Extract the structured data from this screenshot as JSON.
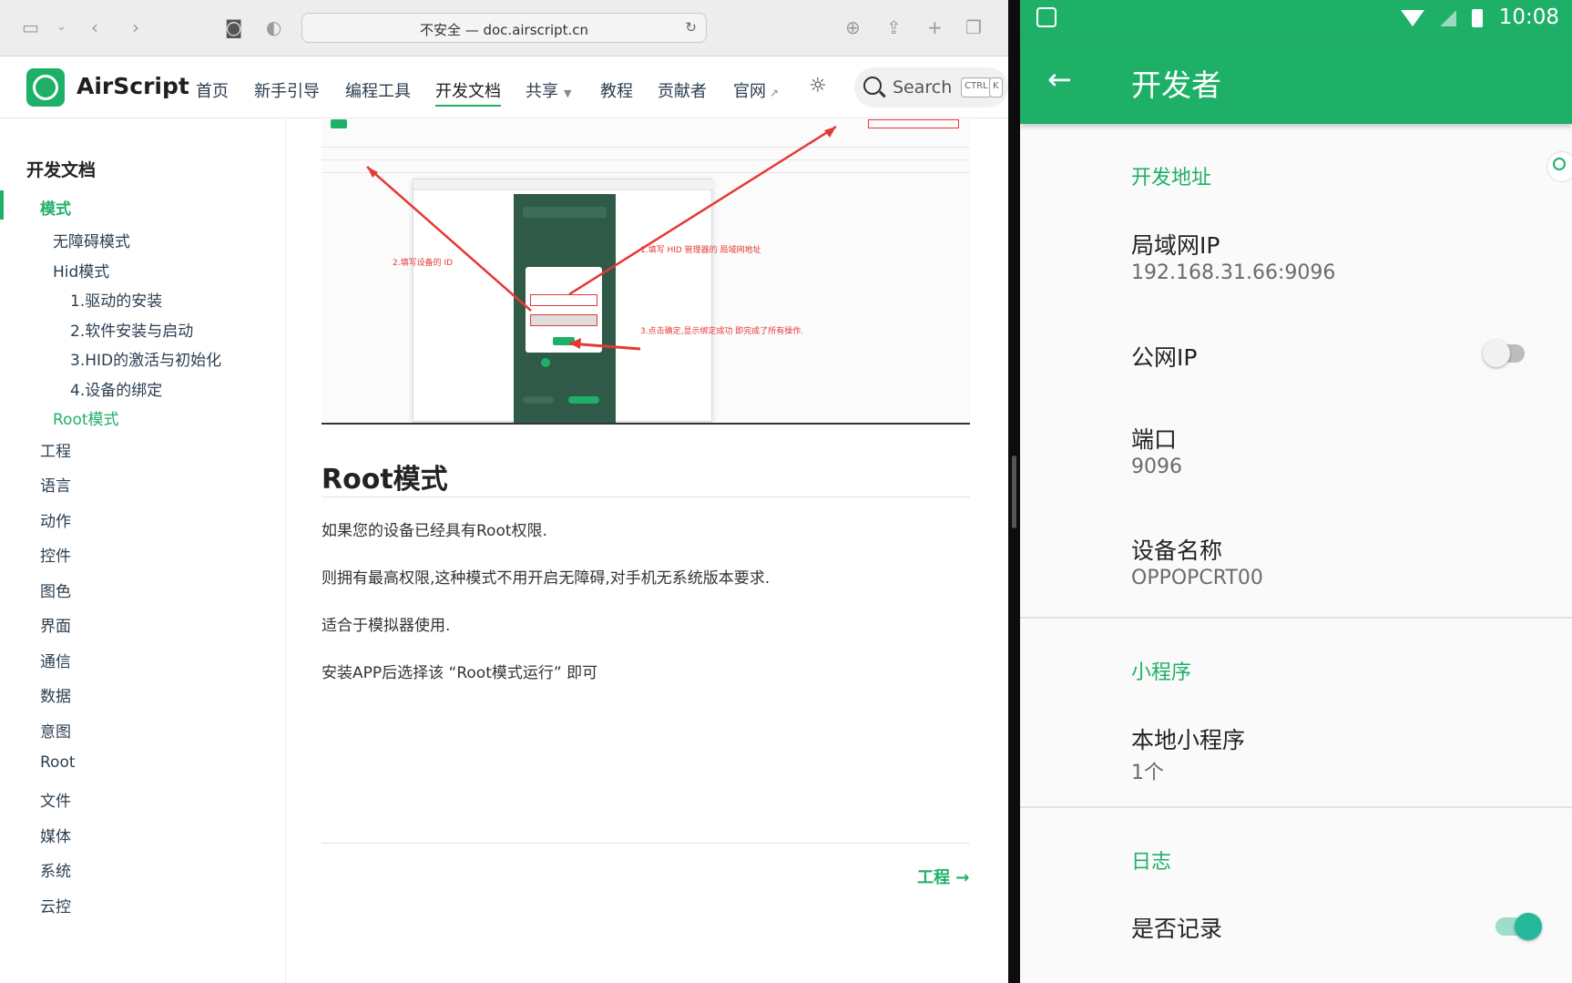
{
  "browser": {
    "address": "不安全 — doc.airscript.cn",
    "brand": "AirScript",
    "nav": [
      {
        "label": "首页"
      },
      {
        "label": "新手引导"
      },
      {
        "label": "编程工具"
      },
      {
        "label": "开发文档"
      },
      {
        "label": "共享"
      },
      {
        "label": "教程"
      },
      {
        "label": "贡献者"
      },
      {
        "label": "官网"
      }
    ],
    "search": {
      "placeholder": "Search",
      "key1": "CTRL",
      "key2": "K"
    },
    "sidebar": {
      "title": "开发文档",
      "items": [
        {
          "label": "模式"
        },
        {
          "label": "无障碍模式"
        },
        {
          "label": "Hid模式"
        },
        {
          "label": "1.驱动的安装"
        },
        {
          "label": "2.软件安装与启动"
        },
        {
          "label": "3.HID的激活与初始化"
        },
        {
          "label": "4.设备的绑定"
        },
        {
          "label": "Root模式"
        },
        {
          "label": "工程"
        },
        {
          "label": "语言"
        },
        {
          "label": "动作"
        },
        {
          "label": "控件"
        },
        {
          "label": "图色"
        },
        {
          "label": "界面"
        },
        {
          "label": "通信"
        },
        {
          "label": "数据"
        },
        {
          "label": "意图"
        },
        {
          "label": "Root"
        },
        {
          "label": "文件"
        },
        {
          "label": "媒体"
        },
        {
          "label": "系统"
        },
        {
          "label": "云控"
        }
      ]
    },
    "figure": {
      "annotations": [
        "1.填写 HID 管理器的 局域网地址",
        "2.填写设备的 ID",
        "3.点击确定,显示绑定成功 即完成了所有操作."
      ]
    },
    "article": {
      "heading": "Root模式",
      "paragraphs": [
        "如果您的设备已经具有Root权限.",
        "则拥有最高权限,这种模式不用开启无障碍,对手机无系统版本要求.",
        "适合于模拟器使用.",
        "安装APP后选择该 “Root模式运行” 即可"
      ],
      "next": "工程 →"
    }
  },
  "android": {
    "status": {
      "time": "10:08"
    },
    "title": "开发者",
    "sections": [
      {
        "header": "开发地址",
        "items": [
          {
            "title": "局域网IP",
            "summary": "192.168.31.66:9096"
          },
          {
            "title": "公网IP",
            "summary": "",
            "toggle": false
          },
          {
            "title": "端口",
            "summary": "9096"
          },
          {
            "title": "设备名称",
            "summary": "OPPOPCRT00"
          }
        ]
      },
      {
        "header": "小程序",
        "items": [
          {
            "title": "本地小程序",
            "summary": "1个"
          }
        ]
      },
      {
        "header": "日志",
        "items": [
          {
            "title": "是否记录",
            "summary": "",
            "toggle": true
          }
        ]
      }
    ]
  },
  "colors": {
    "accent": "#1fb068",
    "toggle_on": "#26b89a",
    "toggle_off": "#bdbdbd"
  }
}
